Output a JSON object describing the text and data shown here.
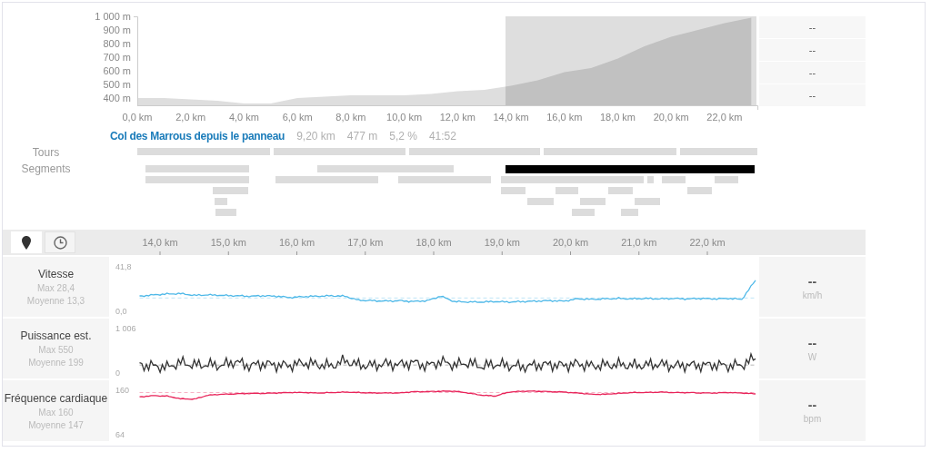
{
  "elevation": {
    "stats": [
      "--",
      "--",
      "--",
      "--"
    ],
    "chart_data": {
      "type": "area",
      "x": [
        0,
        1,
        2,
        3,
        4,
        5,
        6,
        7,
        8,
        9,
        10,
        11,
        12,
        13,
        14,
        15,
        16,
        17,
        18,
        19,
        20,
        21,
        22,
        23
      ],
      "series": [
        {
          "color": "#dedede",
          "values": [
            400,
            400,
            390,
            380,
            360,
            360,
            400,
            410,
            420,
            420,
            420,
            430,
            450,
            460,
            490,
            530,
            590,
            620,
            690,
            780,
            850,
            900,
            950,
            990
          ]
        }
      ],
      "ylim": [
        347,
        1000
      ],
      "xlim": [
        0,
        23.25
      ],
      "xticks": [
        {
          "value": 0,
          "label": "0,0 km"
        },
        {
          "value": 2,
          "label": "2,0 km"
        },
        {
          "value": 4,
          "label": "4,0 km"
        },
        {
          "value": 6,
          "label": "6,0 km"
        },
        {
          "value": 8,
          "label": "8,0 km"
        },
        {
          "value": 10,
          "label": "10,0 km"
        },
        {
          "value": 12,
          "label": "12,0 km"
        },
        {
          "value": 14,
          "label": "14,0 km"
        },
        {
          "value": 16,
          "label": "16,0 km"
        },
        {
          "value": 18,
          "label": "18,0 km"
        },
        {
          "value": 20,
          "label": "20,0 km"
        },
        {
          "value": 22,
          "label": "22,0 km"
        }
      ],
      "yticks": [
        {
          "value": 400,
          "label": "400 m"
        },
        {
          "value": 500,
          "label": "500 m"
        },
        {
          "value": 600,
          "label": "600 m"
        },
        {
          "value": 700,
          "label": "700 m"
        },
        {
          "value": 800,
          "label": "800 m"
        },
        {
          "value": 900,
          "label": "900 m"
        },
        {
          "value": 1000,
          "label": "1 000 m"
        }
      ]
    }
  },
  "segment_info": {
    "name": "Col des Marrous depuis le panneau",
    "stats": [
      "9,20 km",
      "477 m",
      "5,2 %",
      "41:52"
    ]
  },
  "tours": {
    "label": "Tours"
  },
  "segments": {
    "label": "Segments",
    "lanes": [
      {
        "bars": [
          {
            "selected": false
          },
          {
            "selected": false
          },
          {
            "selected": true
          }
        ]
      },
      {
        "bars": [
          {
            "selected": false
          },
          {
            "selected": false
          },
          {
            "selected": false
          },
          {
            "selected": false
          },
          {
            "selected": false
          },
          {
            "selected": false
          },
          {
            "selected": false
          }
        ]
      },
      {
        "bars": [
          {
            "selected": false
          },
          {
            "selected": false
          },
          {
            "selected": false
          },
          {
            "selected": false
          },
          {
            "selected": false
          }
        ]
      },
      {
        "bars": [
          {
            "selected": false
          },
          {
            "selected": false
          },
          {
            "selected": false
          },
          {
            "selected": false
          }
        ]
      },
      {
        "bars": [
          {
            "selected": false
          },
          {
            "selected": false
          },
          {
            "selected": false
          }
        ]
      }
    ]
  },
  "toggles": [
    {
      "kind": "pin",
      "selected": true
    },
    {
      "kind": "clock",
      "selected": false
    }
  ],
  "distance_axis": {
    "ticks": [
      "14,0 km",
      "15,0 km",
      "16,0 km",
      "17,0 km",
      "18,0 km",
      "19,0 km",
      "20,0 km",
      "21,0 km",
      "22,0 km"
    ]
  },
  "metrics": [
    {
      "name": "Vitesse",
      "max": "Max 28,4",
      "average": "Moyenne 13,3",
      "scale_max": "41,8",
      "scale_min": "0,0",
      "value": "--",
      "unit": "km/h",
      "color": "#4db8e8"
    },
    {
      "name": "Puissance est.",
      "max": "Max 550",
      "average": "Moyenne 199",
      "scale_max": "1 006",
      "scale_min": "0",
      "value": "--",
      "unit": "W",
      "color": "#333333"
    },
    {
      "name": "Fréquence cardiaque",
      "max": "Max 160",
      "average": "Moyenne 147",
      "scale_max": "160",
      "scale_min": "64",
      "value": "--",
      "unit": "bpm",
      "color": "#e8245a"
    }
  ]
}
